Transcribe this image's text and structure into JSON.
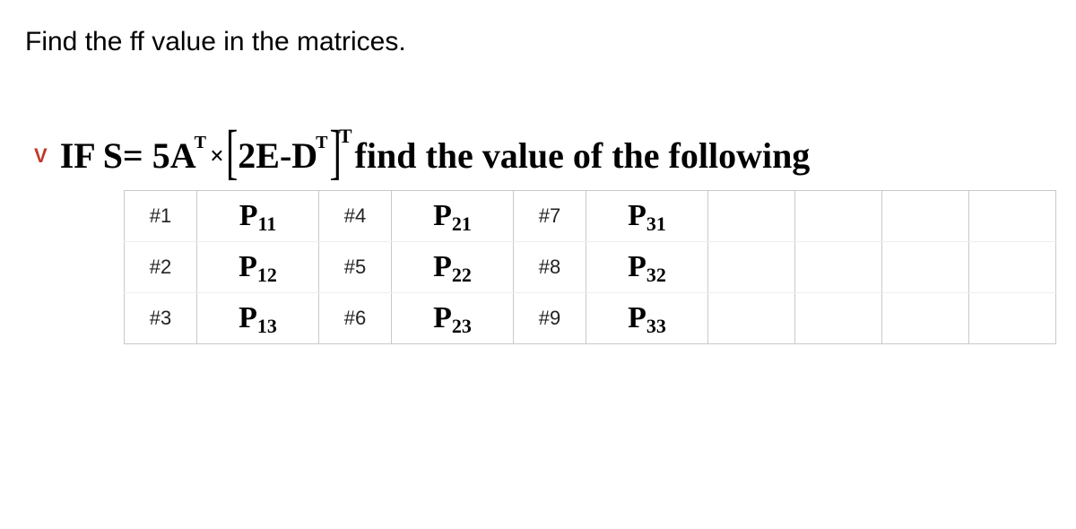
{
  "instruction": "Find the ff value in the matrices.",
  "badge": "V",
  "prompt": {
    "ifword": "IF ",
    "s_eq": "S= 5A",
    "supT1": "T",
    "mult": "×",
    "lbr": "[",
    "inner_a": "2E-D",
    "supT2": "T",
    "rbr": "]",
    "outerT": "T",
    "trail": " find the value of the following"
  },
  "rows": [
    {
      "n1": "#1",
      "p1i": "P",
      "p1s": "11",
      "n2": "#4",
      "p2i": "P",
      "p2s": "21",
      "n3": "#7",
      "p3i": "P",
      "p3s": "31"
    },
    {
      "n1": "#2",
      "p1i": "P",
      "p1s": "12",
      "n2": "#5",
      "p2i": "P",
      "p2s": "22",
      "n3": "#8",
      "p3i": "P",
      "p3s": "32"
    },
    {
      "n1": "#3",
      "p1i": "P",
      "p1s": "13",
      "n2": "#6",
      "p2i": "P",
      "p2s": "23",
      "n3": "#9",
      "p3i": "P",
      "p3s": "33"
    }
  ]
}
